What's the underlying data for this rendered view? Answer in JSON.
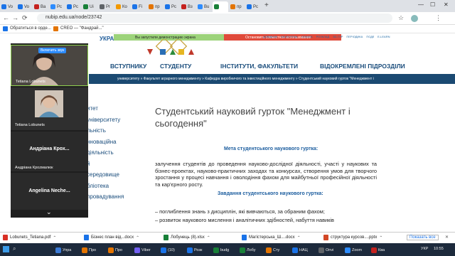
{
  "browser": {
    "tabs": [
      {
        "label": "Vo",
        "color": "#1a73e8"
      },
      {
        "label": "Vo",
        "color": "#1a73e8"
      },
      {
        "label": "Ва",
        "color": "#c5221f"
      },
      {
        "label": "Pc",
        "color": "#2d8cff"
      },
      {
        "label": "Рc",
        "color": "#1a73e8"
      },
      {
        "label": "Ui",
        "color": "#188038"
      },
      {
        "label": "Pr",
        "color": "#5f6368"
      },
      {
        "label": "Ко",
        "color": "#f29900"
      },
      {
        "label": "Fi",
        "color": "#1a73e8"
      },
      {
        "label": "пр",
        "color": "#e37400"
      },
      {
        "label": "Pc",
        "color": "#1a73e8"
      },
      {
        "label": "Вз",
        "color": "#c5221f"
      },
      {
        "label": "Bu",
        "color": "#2d8cff"
      },
      {
        "label": "",
        "color": "#188038"
      },
      {
        "label": "пр",
        "color": "#e37400"
      },
      {
        "label": "Pc",
        "color": "#1a73e8"
      }
    ],
    "active_tab_index": 13,
    "new_tab": "+",
    "controls": {
      "minimize": "—",
      "maximize": "☐",
      "close": "✕"
    },
    "url": "nubip.edu.ua/node/23742",
    "bookmarks": [
      {
        "label": "Обратиться в орде..."
      },
      {
        "label": "CREO — \"Фандрай...\""
      }
    ]
  },
  "website": {
    "university_fragment": "УКРАЇНИ",
    "notice_green": "Вы запустили демонстрацию экрана",
    "notice_red": "Остановить совместное использование",
    "top_links": [
      "ДОВІДНИК",
      "БІБЛІОТЕКА",
      "ОПЛАТА",
      "РОЗКЛАД",
      "3D-ТУР",
      "ПЕРІОДИКА",
      "ПОДІЇ",
      "E-LEARN"
    ],
    "nav": [
      "ВСТУПНИКУ",
      "СТУДЕНТУ",
      "ІНСТИТУТИ, ФАКУЛЬТЕТИ",
      "ВІДОКРЕМЛЕНІ ПІДРОЗДІЛИ"
    ],
    "breadcrumb": "университету » Факультет аграрного менеджменту » Кафедра виробничого та інвестиційного менеджменту » Студентський науковий гурток \"Менеджмент і",
    "sidebar": [
      "итет",
      "університету",
      "льність",
      "нноваційна",
      "діяльність",
      "й",
      "середовище",
      "бліотека",
      "провадування"
    ],
    "title": "Студентський науковий гурток \"Менеджмент і сьогодення\"",
    "goal_heading": "Мета студентського наукового гуртка:",
    "goal_text": "залучення студентів до проведення науково-дослідної діяльності, участі у наукових та бізнес-проектах, науково-практичних заходах та конкурсах, створення умов для творчого зростання у процесі навчання і оволодіння фахом для майбутньої професійної діяльності та кар'єрного росту.",
    "tasks_heading": "Завдання студентського наукового гуртка:",
    "tasks": [
      "– поглиблення знань з дисциплін, які вивчаються, за обраним фахом;",
      "–  розвиток наукового мислення і аналітичних здібностей, набуття навиків"
    ]
  },
  "zoom": {
    "share_label": "Включить звук",
    "participants": [
      {
        "name": "Tetiana Lobunets",
        "kind": "video-dark"
      },
      {
        "name": "Tetiana Lobunets",
        "kind": "photo"
      },
      {
        "name": "Андріана Кроzмалюк",
        "big": "Андріана Крох...",
        "kind": "name"
      },
      {
        "name": "",
        "big": "Angelina Neche...",
        "kind": "name"
      }
    ],
    "scroll_hint": "⌄"
  },
  "downloads": {
    "items": [
      {
        "label": "Lobunets_Tetiana.pdf",
        "color": "#d93025"
      },
      {
        "label": "Бізнес план від...docx",
        "color": "#1a73e8"
      },
      {
        "label": "Лобунець (8).xlsx",
        "color": "#188038"
      },
      {
        "label": "Магістерська_Ш....docx",
        "color": "#1a73e8"
      },
      {
        "label": "структура курсов....pptx",
        "color": "#d24726"
      }
    ],
    "show_all": "Показать все",
    "close": "✕"
  },
  "taskbar": {
    "items": [
      {
        "label": "Упра",
        "color": "#3c7bd6"
      },
      {
        "label": "Про",
        "color": "#e37400"
      },
      {
        "label": "Про",
        "color": "#e37400"
      },
      {
        "label": "Viber",
        "color": "#7360f2"
      },
      {
        "label": "(10)",
        "color": "#1a73e8"
      },
      {
        "label": "Розк",
        "color": "#1a73e8"
      },
      {
        "label": "budg",
        "color": "#188038"
      },
      {
        "label": "Лобу",
        "color": "#188038"
      },
      {
        "label": "Сту",
        "color": "#e37400"
      },
      {
        "label": "НАЦ",
        "color": "#1a73e8"
      },
      {
        "label": "Onvi",
        "color": "#5f6368"
      },
      {
        "label": "Zoom",
        "color": "#2d8cff"
      },
      {
        "label": "Ква",
        "color": "#c5221f"
      }
    ],
    "lang": "УКР",
    "time": "10:55"
  }
}
